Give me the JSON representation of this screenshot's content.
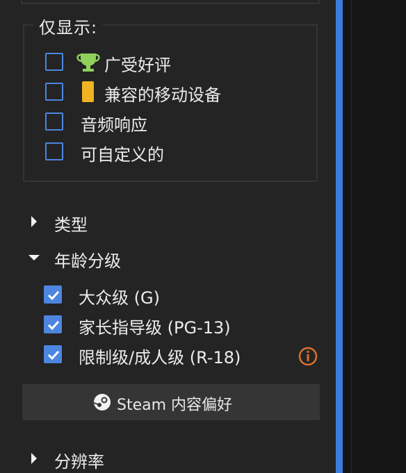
{
  "only_show": {
    "title": "仅显示:",
    "items": [
      {
        "label": "广受好评",
        "checked": false,
        "icon": "trophy-icon"
      },
      {
        "label": "兼容的移动设备",
        "checked": false,
        "icon": "mobile-device-icon"
      },
      {
        "label": "音频响应",
        "checked": false,
        "icon": ""
      },
      {
        "label": "可自定义的",
        "checked": false,
        "icon": ""
      }
    ]
  },
  "sections": {
    "type_label": "类型",
    "age_rating_label": "年龄分级",
    "resolution_label": "分辨率"
  },
  "age_rating": {
    "items": [
      {
        "label": "大众级 (G)",
        "checked": true
      },
      {
        "label": "家长指导级 (PG-13)",
        "checked": true
      },
      {
        "label": "限制级/成人级 (R-18)",
        "checked": true,
        "info_icon": "info-icon"
      }
    ]
  },
  "steam_button": {
    "label": "Steam 内容偏好",
    "icon": "steam-logo-icon"
  },
  "colors": {
    "accent_blue": "#4d86e0",
    "scrollbar_blue": "#3a7bdc",
    "trophy_green": "#8fd15a",
    "device_yellow": "#f0b323",
    "info_orange": "#d9712e",
    "background": "#242424"
  }
}
